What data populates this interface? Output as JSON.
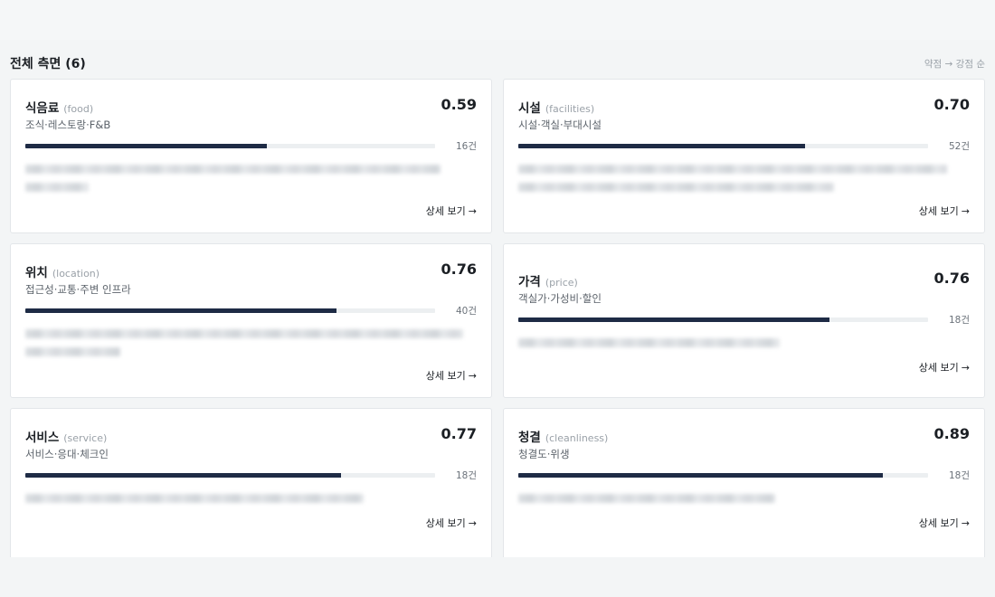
{
  "section": {
    "title": "전체 측면 (6)",
    "sort_label": "약점 → 강점 순"
  },
  "aspects": [
    {
      "name": "식음료",
      "en": "(food)",
      "subtitle": "조식·레스토랑·F&B",
      "score": "0.59",
      "score_value": 0.59,
      "count": "16건",
      "detail_label": "상세 보기",
      "arrow": "→",
      "blur_lines": [
        0.92,
        0.14
      ]
    },
    {
      "name": "시설",
      "en": "(facilities)",
      "subtitle": "시설·객실·부대시설",
      "score": "0.70",
      "score_value": 0.7,
      "count": "52건",
      "detail_label": "상세 보기",
      "arrow": "→",
      "blur_lines": [
        0.95,
        0.7
      ]
    },
    {
      "name": "위치",
      "en": "(location)",
      "subtitle": "접근성·교통·주변 인프라",
      "score": "0.76",
      "score_value": 0.76,
      "count": "40건",
      "detail_label": "상세 보기",
      "arrow": "→",
      "blur_lines": [
        0.97,
        0.21
      ]
    },
    {
      "name": "가격",
      "en": "(price)",
      "subtitle": "객실가·가성비·할인",
      "score": "0.76",
      "score_value": 0.76,
      "count": "18건",
      "detail_label": "상세 보기",
      "arrow": "→",
      "blur_lines": [
        0.58
      ]
    },
    {
      "name": "서비스",
      "en": "(service)",
      "subtitle": "서비스·응대·체크인",
      "score": "0.77",
      "score_value": 0.77,
      "count": "18건",
      "detail_label": "상세 보기",
      "arrow": "→",
      "blur_lines": [
        0.75
      ]
    },
    {
      "name": "청결",
      "en": "(cleanliness)",
      "subtitle": "청결도·위생",
      "score": "0.89",
      "score_value": 0.89,
      "count": "18건",
      "detail_label": "상세 보기",
      "arrow": "→",
      "blur_lines": [
        0.57
      ]
    }
  ],
  "colors": {
    "bar_fill": "#1e2b45",
    "bar_track": "#eceff1",
    "background": "#f3f5f6"
  }
}
